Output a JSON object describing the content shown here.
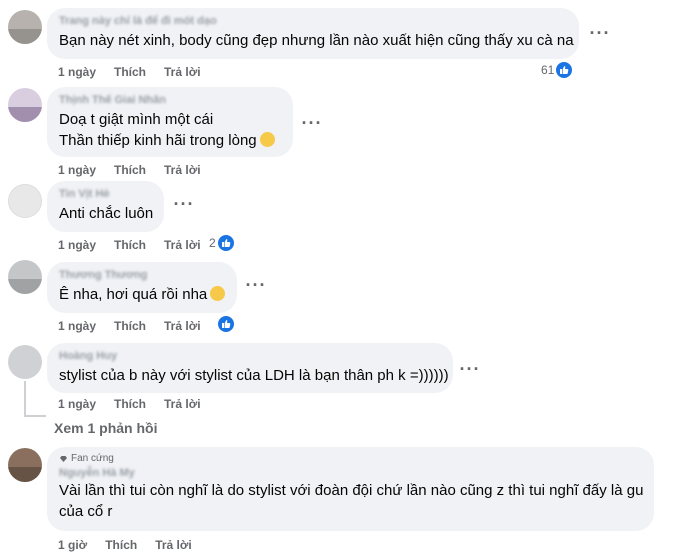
{
  "comments": [
    {
      "name": "Trang này chỉ là để đi mót dạo",
      "text_lines": [
        "Bạn này nét xinh, body cũng đẹp nhưng lần nào xuất hiện cũng thấy xu cà na"
      ],
      "time": "1 ngày",
      "like": "Thích",
      "reply": "Trả lời",
      "reaction_count": "61"
    },
    {
      "name": "Thịnh Thế Giai Nhân",
      "text_lines": [
        "Doạ t giật mình một cái",
        "Thần thiếp kinh hãi trong lòng"
      ],
      "time": "1 ngày",
      "like": "Thích",
      "reply": "Trả lời"
    },
    {
      "name": "Tin Vịt Hè",
      "text_lines": [
        "Anti chắc luôn"
      ],
      "time": "1 ngày",
      "like": "Thích",
      "reply": "Trả lời",
      "reaction_count": "2"
    },
    {
      "name": "Thương Thương",
      "text_lines": [
        "Ê nha, hơi quá rồi nha"
      ],
      "time": "1 ngày",
      "like": "Thích",
      "reply": "Trả lời"
    },
    {
      "name": "Hoàng Huy",
      "text_lines": [
        "stylist của b này với stylist của LDH là bạn thân ph k =))))))"
      ],
      "time": "1 ngày",
      "like": "Thích",
      "reply": "Trả lời"
    },
    {
      "badge": "Fan cứng",
      "name": "Nguyễn Hà My",
      "text_lines": [
        "Vài lần thì tui còn nghĩ là do stylist với đoàn đội chứ lần nào cũng z thì tui nghĩ đấy là gu",
        "của cổ r"
      ],
      "time": "1 giờ",
      "like": "Thích",
      "reply": "Trả lời"
    }
  ],
  "view_replies": "Xem 1 phản hồi",
  "colors": {
    "bubble": "#f0f2f5",
    "meta": "#65676b",
    "like_blue": "#1b74e4"
  }
}
